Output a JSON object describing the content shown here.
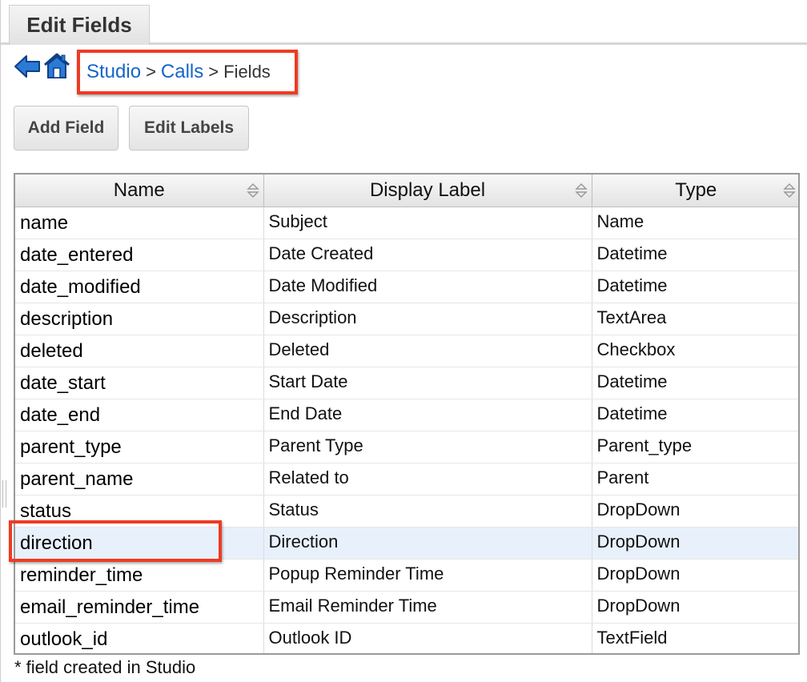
{
  "tab": {
    "label": "Edit Fields"
  },
  "nav": {
    "back_icon": "back-arrow-icon",
    "home_icon": "home-icon"
  },
  "breadcrumb": {
    "items": [
      {
        "label": "Studio",
        "link": true
      },
      {
        "label": "Calls",
        "link": true
      },
      {
        "label": "Fields",
        "link": false
      }
    ],
    "separator": ">"
  },
  "toolbar": {
    "add_field_label": "Add Field",
    "edit_labels_label": "Edit Labels"
  },
  "table": {
    "headers": [
      "Name",
      "Display Label",
      "Type"
    ],
    "rows": [
      {
        "name": "name",
        "label": "Subject",
        "type": "Name"
      },
      {
        "name": "date_entered",
        "label": "Date Created",
        "type": "Datetime"
      },
      {
        "name": "date_modified",
        "label": "Date Modified",
        "type": "Datetime"
      },
      {
        "name": "description",
        "label": "Description",
        "type": "TextArea"
      },
      {
        "name": "deleted",
        "label": "Deleted",
        "type": "Checkbox"
      },
      {
        "name": "date_start",
        "label": "Start Date",
        "type": "Datetime"
      },
      {
        "name": "date_end",
        "label": "End Date",
        "type": "Datetime"
      },
      {
        "name": "parent_type",
        "label": "Parent Type",
        "type": "Parent_type"
      },
      {
        "name": "parent_name",
        "label": "Related to",
        "type": "Parent"
      },
      {
        "name": "status",
        "label": "Status",
        "type": "DropDown"
      },
      {
        "name": "direction",
        "label": "Direction",
        "type": "DropDown"
      },
      {
        "name": "reminder_time",
        "label": "Popup Reminder Time",
        "type": "DropDown"
      },
      {
        "name": "email_reminder_time",
        "label": "Email Reminder Time",
        "type": "DropDown"
      },
      {
        "name": "outlook_id",
        "label": "Outlook ID",
        "type": "TextField"
      }
    ],
    "highlighted_row": "direction"
  },
  "footnote": "* field created in Studio",
  "colors": {
    "link": "#1665c8",
    "callout": "#ee3b24",
    "row_highlight": "#e8f1fb"
  }
}
